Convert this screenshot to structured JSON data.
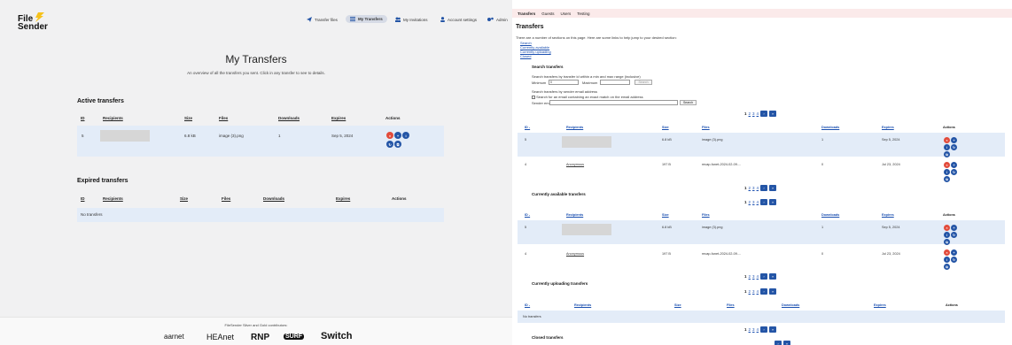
{
  "app": {
    "logo_line1": "File",
    "logo_line2": "Sender"
  },
  "nav": {
    "transfer_files": "Transfer files",
    "my_transfers": "My Transfers",
    "my_invitations": "My Invitations",
    "account_settings": "Account settings",
    "admin": "Admin"
  },
  "page": {
    "title": "My Transfers",
    "subtitle": "An overview of all the transfers you sent. Click in any transfer to see to details."
  },
  "active": {
    "heading": "Active transfers",
    "columns": {
      "id": "ID",
      "recipients": "Recipients",
      "size": "Size",
      "files": "Files",
      "downloads": "Downloads",
      "expires": "Expires",
      "actions": "Actions"
    },
    "rows": [
      {
        "id": "5",
        "size": "6.8 kB",
        "files": "image (3).png",
        "downloads": "1",
        "expires": "Sep 5, 2024"
      }
    ]
  },
  "expired": {
    "heading": "Expired transfers",
    "columns": {
      "id": "ID",
      "recipients": "Recipients",
      "size": "Size",
      "files": "Files",
      "downloads": "Downloads",
      "expires": "Expires",
      "actions": "Actions"
    },
    "empty": "No transfers"
  },
  "footer": {
    "text": "FileSender Silver and Gold contributors:",
    "sponsors": [
      "aarnet",
      "HEAnet",
      "RNP",
      "SURF",
      "Switch"
    ]
  },
  "admin": {
    "tabs": [
      "Transfers",
      "Guests",
      "Users",
      "Testing"
    ],
    "title": "Transfers",
    "intro": "There are a number of sections on this page. Here are some links to help jump to your desired section:",
    "links": [
      "Search",
      "Currently available",
      "Currently uploading",
      "Closed"
    ],
    "search_heading": "Search transfers",
    "search_by_id": "Search transfers by transfer id within a min and max range (inclusive)",
    "min_label": "Minimum",
    "min_value": "0",
    "max_label": "Maximum",
    "search_button": "Search",
    "search_by_email": "Search transfers by sender email address",
    "exact_match": "Search for an email containing an exact match on the email address",
    "sender_email_label": "Sender email",
    "pager": [
      "1",
      "2",
      "3",
      "4"
    ],
    "columns": {
      "id": "ID -",
      "recipients": "Recipients",
      "size": "Size",
      "files": "Files",
      "downloads": "Downloads",
      "expires": "Expires",
      "actions": "Actions"
    },
    "rows": [
      {
        "id": "5",
        "recipients": "",
        "size": "6.8 kB",
        "files": "image (3).png",
        "downloads": "1",
        "expires": "Sep 5, 2024"
      },
      {
        "id": "4",
        "recipients": "Anonymous",
        "size": "197 B",
        "files": "recap-funet-2024-02-09....",
        "downloads": "0",
        "expires": "Jul 23, 2024"
      }
    ],
    "available_heading": "Currently available transfers",
    "uploading_heading": "Currently uploading transfers",
    "uploading_empty": "No transfers",
    "closed_heading": "Closed transfers"
  }
}
